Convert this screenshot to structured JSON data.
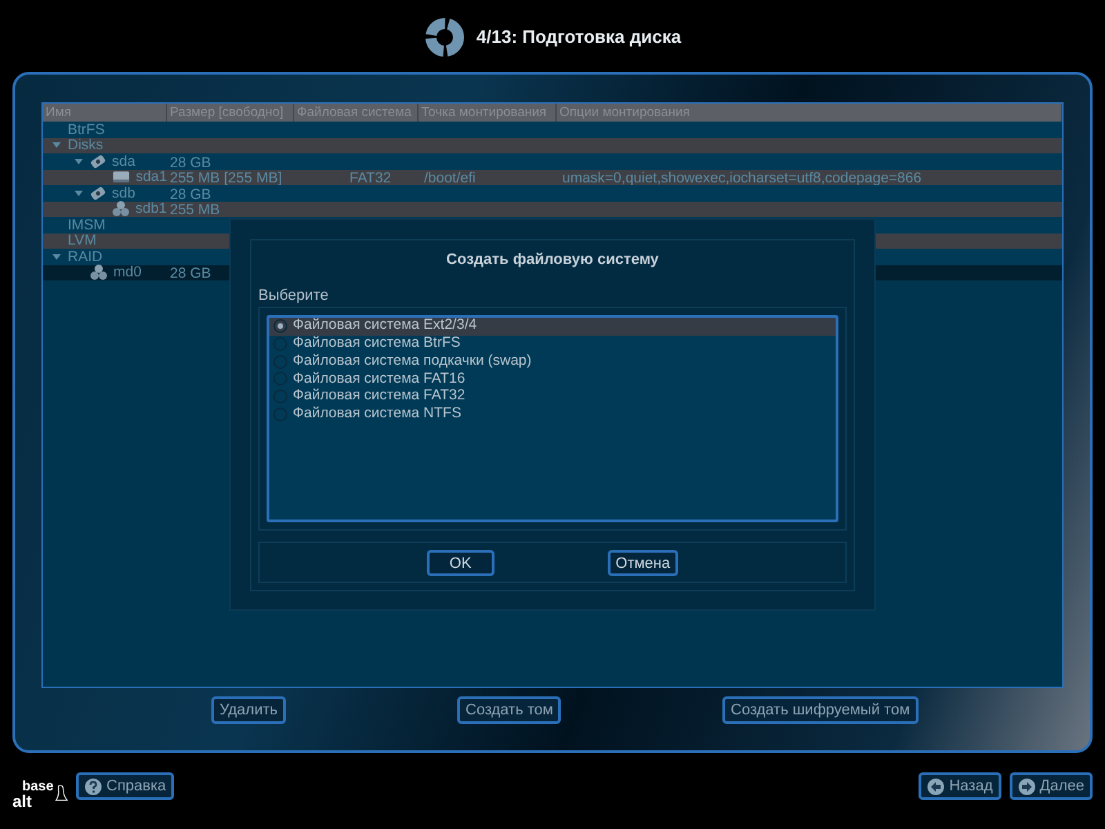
{
  "header": {
    "title": "4/13: Подготовка диска"
  },
  "table": {
    "columns": [
      "Имя",
      "Размер [свободно]",
      "Файловая система",
      "Точка монтирования",
      "Опции монтирования"
    ],
    "rows": [
      {
        "name": "BtrFS",
        "selected": false
      },
      {
        "name": "Disks",
        "expanded": true,
        "selected": false,
        "children": [
          {
            "name": "sda",
            "kind": "disk",
            "size": "28 GB",
            "expanded": true,
            "selected": false,
            "children": [
              {
                "name": "sda1",
                "kind": "partition",
                "size": "255 MB [255 MB]",
                "fs": "FAT32",
                "mount": "/boot/efi",
                "options": "umask=0,quiet,showexec,iocharset=utf8,codepage=866",
                "selected": false
              }
            ]
          },
          {
            "name": "sdb",
            "kind": "disk",
            "size": "28 GB",
            "expanded": true,
            "selected": false,
            "children": [
              {
                "name": "sdb1",
                "kind": "raid",
                "size": "255 MB",
                "selected": false
              }
            ]
          }
        ]
      },
      {
        "name": "IMSM",
        "selected": false
      },
      {
        "name": "LVM",
        "selected": false
      },
      {
        "name": "RAID",
        "expanded": true,
        "selected": false,
        "children": [
          {
            "name": "md0",
            "kind": "raid",
            "size": "28 GB",
            "selected": true
          }
        ]
      }
    ]
  },
  "actions": [
    "Удалить",
    "Создать том",
    "Создать шифруемый том"
  ],
  "dialog": {
    "title": "Создать файловую систему",
    "label": "Выберите",
    "options": [
      {
        "label": "Файловая система Ext2/3/4",
        "selected": true
      },
      {
        "label": "Файловая система BtrFS",
        "selected": false
      },
      {
        "label": "Файловая система подкачки (swap)",
        "selected": false
      },
      {
        "label": "Файловая система FAT16",
        "selected": false
      },
      {
        "label": "Файловая система FAT32",
        "selected": false
      },
      {
        "label": "Файловая система NTFS",
        "selected": false
      }
    ],
    "buttons": [
      "OK",
      "Отмена"
    ]
  },
  "footer": {
    "logo": [
      "base",
      "alt"
    ],
    "help": "Справка",
    "back": "Назад",
    "next": "Далее"
  }
}
